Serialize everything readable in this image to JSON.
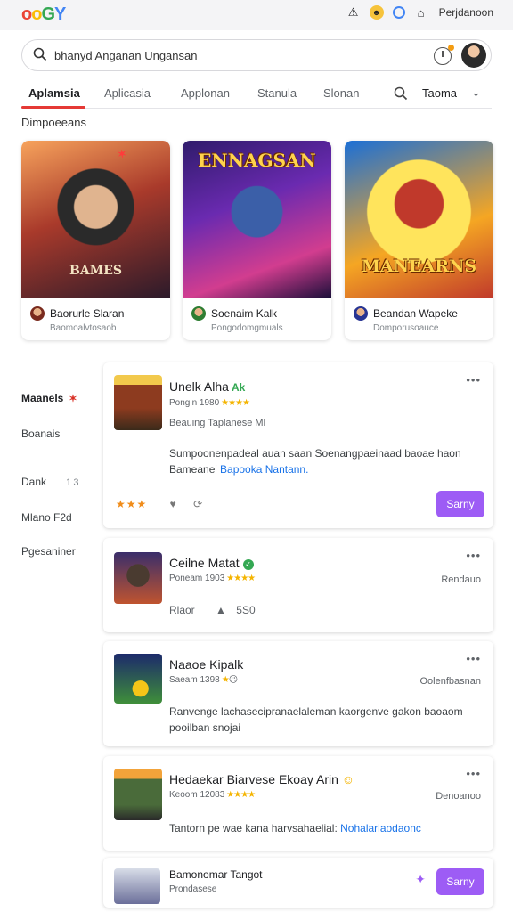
{
  "app": {
    "logo": [
      "o",
      "o",
      "G",
      "Y"
    ],
    "user_name": "Perjdanoon"
  },
  "search": {
    "value": "bhanyd Anganan Ungansan"
  },
  "tabs": [
    {
      "label": "Aplamsia",
      "active": true
    },
    {
      "label": "Aplicasia"
    },
    {
      "label": "Applonan"
    },
    {
      "label": "Stanula"
    },
    {
      "label": "Slonan"
    }
  ],
  "tab_more": {
    "label": "Taoma"
  },
  "section": {
    "title": "Dimpoeeans"
  },
  "featured": [
    {
      "art_title": "BAMES",
      "name": "Baorurle Slaran",
      "sub": "Baomoalvtosaob"
    },
    {
      "art_title": "ENNAGSAN",
      "name": "Soenaim Kalk",
      "sub": "Pongodomgmuals"
    },
    {
      "art_title": "MANEARNS",
      "name": "Beandan Wapeke",
      "sub": "Domporusoauce"
    }
  ],
  "sidebar": [
    {
      "label": "Maanels",
      "active": true,
      "mark": "✶"
    },
    {
      "label": "Boanais"
    },
    {
      "label": "Dank",
      "count": "1 3"
    },
    {
      "label": "Mlano F2d"
    },
    {
      "label": "Pgesaniner"
    }
  ],
  "posts": [
    {
      "title": "Unelk Alha",
      "tag": "Ak",
      "meta": "Pongin 1980",
      "stars": "★★★★",
      "line": "Beauing Taplanese Ml",
      "text_main": "Sumpoonenpadeal auan saan Soenangpaeinaad baoae haon Bameane'",
      "text_link": "Bapooka Nantann.",
      "reactions": "★★★",
      "button": "Sarny"
    },
    {
      "title": "Ceilne Matat",
      "meta": "Poneam 1903",
      "stars": "★★★★",
      "right": "Rendauo",
      "stat_label": "Rlaor",
      "stat_value": "5S0"
    },
    {
      "title": "Naaoe Kipalk",
      "meta": "Saeam 1398",
      "stars": "★",
      "right": "Oolenfbasnan",
      "text_main": "Ranvenge lachasecipranaelaleman kaorgenve gakon baoaom pooilban snojai"
    },
    {
      "title": "Hedaekar Biarvese Ekoay Arin",
      "meta": "Keoom 12083",
      "stars": "★★★★",
      "right": "Denoanoo",
      "text_main": "Tantorn pe wae kana harvsahaelial:",
      "text_link": "Nohalarlaodaonc"
    },
    {
      "title": "Bamonomar Tangot",
      "meta": "Prondasese",
      "button": "Sarny"
    }
  ],
  "colors": {
    "accent": "#9d5cf5",
    "tab_underline": "#e53935",
    "link": "#1a73e8",
    "star": "#f4b400"
  }
}
